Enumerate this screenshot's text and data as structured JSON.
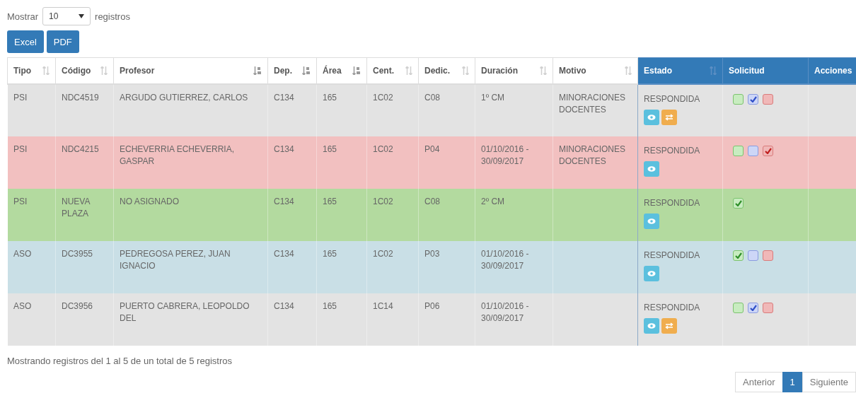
{
  "length_menu": {
    "before": "Mostrar",
    "value": "10",
    "after": "registros"
  },
  "export_buttons": [
    "Excel",
    "PDF"
  ],
  "table": {
    "columns": [
      {
        "label": "Tipo",
        "kind": "sortable",
        "highlighted": false
      },
      {
        "label": "Código",
        "kind": "sortable",
        "highlighted": false
      },
      {
        "label": "Profesor",
        "kind": "sorted",
        "highlighted": false
      },
      {
        "label": "Dep.",
        "kind": "sorted",
        "highlighted": false
      },
      {
        "label": "Área",
        "kind": "sorted",
        "highlighted": false
      },
      {
        "label": "Cent.",
        "kind": "sortable",
        "highlighted": false
      },
      {
        "label": "Dedic.",
        "kind": "sortable",
        "highlighted": false
      },
      {
        "label": "Duración",
        "kind": "sortable",
        "highlighted": false
      },
      {
        "label": "Motivo",
        "kind": "sortable",
        "highlighted": false
      },
      {
        "label": "Estado",
        "kind": "sortable",
        "highlighted": true
      },
      {
        "label": "Solicitud",
        "kind": "plain",
        "highlighted": true
      },
      {
        "label": "Acciones",
        "kind": "plain",
        "highlighted": true
      }
    ],
    "rows": [
      {
        "color": "#e3e3e3",
        "cells": [
          "PSI",
          "NDC4519",
          "ARGUDO GUTIERREZ, CARLOS",
          "C134",
          "165",
          "1C02",
          "C08",
          "1º CM",
          "MINORACIONES DOCENTES"
        ],
        "estado": "RESPONDIDA",
        "actions": [
          {
            "kind": "view"
          },
          {
            "kind": "transfer"
          }
        ],
        "solicitud": [
          {
            "kind": "approve",
            "checked": false
          },
          {
            "kind": "neutral",
            "checked": true
          },
          {
            "kind": "reject",
            "checked": false
          }
        ]
      },
      {
        "color": "#f2c0c0",
        "cells": [
          "PSI",
          "NDC4215",
          "ECHEVERRIA ECHEVERRIA, GASPAR",
          "C134",
          "165",
          "1C02",
          "P04",
          "01/10/2016 - 30/09/2017",
          "MINORACIONES DOCENTES"
        ],
        "estado": "RESPONDIDA",
        "actions": [
          {
            "kind": "view"
          }
        ],
        "solicitud": [
          {
            "kind": "approve",
            "checked": false
          },
          {
            "kind": "neutral",
            "checked": false
          },
          {
            "kind": "reject",
            "checked": true
          }
        ]
      },
      {
        "color": "#b3da9f",
        "cells": [
          "PSI",
          "NUEVA PLAZA",
          "NO ASIGNADO",
          "C134",
          "165",
          "1C02",
          "C08",
          "2º CM"
        ],
        "estado": "RESPONDIDA",
        "actions": [
          {
            "kind": "view"
          }
        ],
        "solicitud": [
          {
            "kind": "approve",
            "checked": true
          }
        ]
      },
      {
        "color": "#c9dfe6",
        "cells": [
          "ASO",
          "DC3955",
          "PEDREGOSA PEREZ, JUAN IGNACIO",
          "C134",
          "165",
          "1C02",
          "P03",
          "01/10/2016 - 30/09/2017"
        ],
        "estado": "RESPONDIDA",
        "actions": [
          {
            "kind": "view"
          }
        ],
        "solicitud": [
          {
            "kind": "approve",
            "checked": true
          },
          {
            "kind": "neutral",
            "checked": false
          },
          {
            "kind": "reject",
            "checked": false
          }
        ]
      },
      {
        "color": "#e3e3e3",
        "cells": [
          "ASO",
          "DC3956",
          "PUERTO CABRERA, LEOPOLDO DEL",
          "C134",
          "165",
          "1C14",
          "P06",
          "01/10/2016 - 30/09/2017"
        ],
        "estado": "RESPONDIDA",
        "actions": [
          {
            "kind": "view"
          },
          {
            "kind": "transfer"
          }
        ],
        "solicitud": [
          {
            "kind": "approve",
            "checked": false
          },
          {
            "kind": "neutral",
            "checked": true
          },
          {
            "kind": "reject",
            "checked": false
          }
        ]
      }
    ]
  },
  "info": "Mostrando registros del 1 al 5 de un total de 5 registros",
  "pagination": [
    {
      "label": "Anterior",
      "selected": false
    },
    {
      "label": "1",
      "selected": true
    },
    {
      "label": "Siguiente",
      "selected": false
    }
  ]
}
